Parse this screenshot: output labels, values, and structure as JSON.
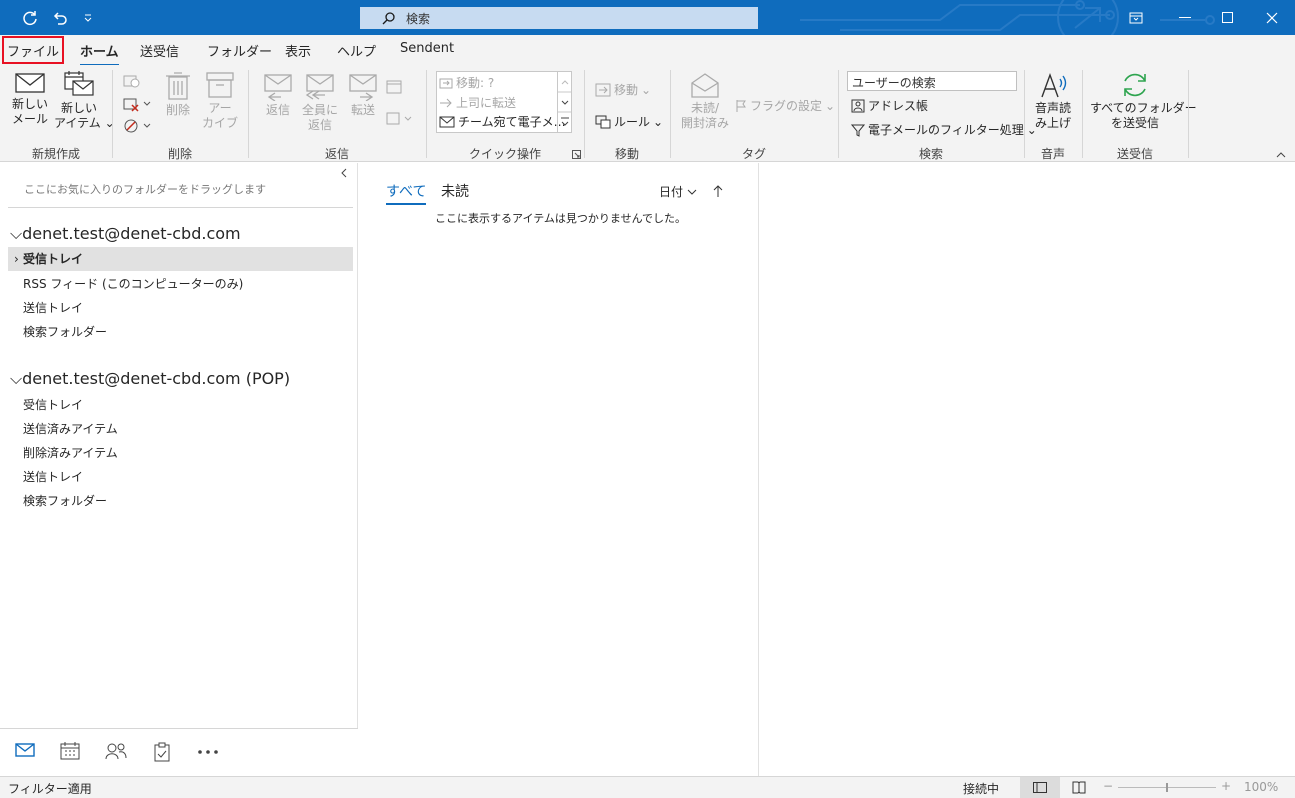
{
  "titlebar": {
    "search_placeholder": "検索",
    "accent": "#0f6cbd"
  },
  "tabs": [
    {
      "label": "ファイル"
    },
    {
      "label": "ホーム"
    },
    {
      "label": "送受信"
    },
    {
      "label": "フォルダー"
    },
    {
      "label": "表示"
    },
    {
      "label": "ヘルプ"
    },
    {
      "label": "Sendent"
    }
  ],
  "ribbon": {
    "new_group": {
      "label": "新規作成",
      "new_mail": [
        "新しい",
        "メール"
      ],
      "new_item": [
        "新しい",
        "アイテム ⌄"
      ]
    },
    "delete_group": {
      "label": "削除",
      "delete": "削除",
      "archive": [
        "アー",
        "カイブ"
      ]
    },
    "respond_group": {
      "label": "返信",
      "reply": "返信",
      "reply_all": [
        "全員に",
        "返信"
      ],
      "forward": "転送"
    },
    "quick_steps": {
      "label": "クイック操作",
      "items": [
        "移動: ?",
        "上司に転送",
        "チーム宛て電子メ…"
      ]
    },
    "move_group": {
      "label": "移動",
      "move": "移動",
      "rules": "ルール"
    },
    "tags_group": {
      "label": "タグ",
      "unread_read": [
        "未読/",
        "開封済み"
      ],
      "follow_up": "フラグの設定"
    },
    "find_group": {
      "label": "検索",
      "search_people": "ユーザーの検索",
      "address_book": "アドレス帳",
      "filter_email": "電子メールのフィルター処理"
    },
    "speech_group": {
      "label": "音声",
      "read_aloud": [
        "音声読",
        "み上げ"
      ]
    },
    "sendreceive_group": {
      "label": "送受信",
      "send_receive_all": [
        "すべてのフォルダー",
        "を送受信"
      ]
    }
  },
  "folders": {
    "favorites_hint": "ここにお気に入りのフォルダーをドラッグします",
    "accounts": [
      {
        "name": "denet.test@denet-cbd.com",
        "items": [
          "受信トレイ",
          "RSS フィード (このコンピューターのみ)",
          "送信トレイ",
          "検索フォルダー"
        ]
      },
      {
        "name": "denet.test@denet-cbd.com (POP)",
        "items": [
          "受信トレイ",
          "送信済みアイテム",
          "削除済みアイテム",
          "送信トレイ",
          "検索フォルダー"
        ]
      }
    ]
  },
  "message_list": {
    "tab_all": "すべて",
    "tab_unread": "未読",
    "sort_label": "日付",
    "empty_text": "ここに表示するアイテムは見つかりませんでした。"
  },
  "statusbar": {
    "filter": "フィルター適用",
    "connection": "接続中",
    "zoom": "100%"
  }
}
